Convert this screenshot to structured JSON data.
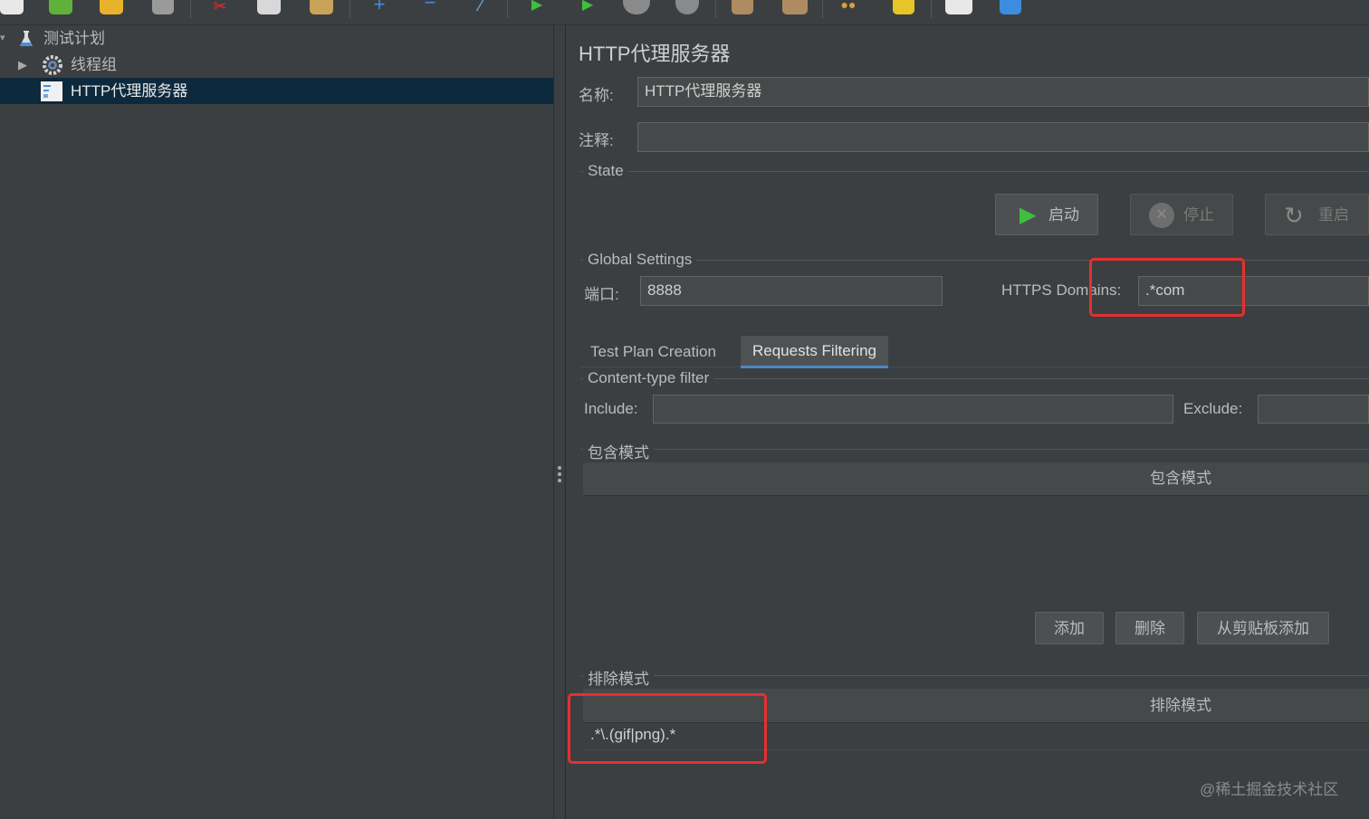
{
  "toolbar": {
    "icons": [
      "new-icon",
      "templates-icon",
      "open-icon",
      "save-icon",
      "cut-icon",
      "copy-icon",
      "paste-icon",
      "expand-icon",
      "collapse-icon",
      "toggle-icon",
      "start-icon",
      "start-no-pause-icon",
      "stop-icon",
      "shutdown-icon",
      "clear-icon",
      "clear-all-icon",
      "search-icon",
      "reset-search-icon",
      "function-helper-icon",
      "help-icon"
    ]
  },
  "tree": {
    "items": [
      {
        "label": "测试计划",
        "icon": "test-plan-icon"
      },
      {
        "label": "线程组",
        "icon": "thread-group-icon"
      },
      {
        "label": "HTTP代理服务器",
        "icon": "proxy-server-icon"
      }
    ]
  },
  "panel": {
    "title": "HTTP代理服务器",
    "name_label": "名称:",
    "name_value": "HTTP代理服务器",
    "comment_label": "注释:",
    "comment_value": "",
    "state": {
      "title": "State",
      "start_label": "启动",
      "stop_label": "停止",
      "restart_label": "重启"
    },
    "global": {
      "title": "Global Settings",
      "port_label": "端口:",
      "port_value": "8888",
      "https_label": "HTTPS Domains:",
      "https_value": ".*com"
    },
    "tabs": [
      {
        "label": "Test Plan Creation",
        "active": false
      },
      {
        "label": "Requests Filtering",
        "active": true
      }
    ],
    "content_filter": {
      "title": "Content-type filter",
      "include_label": "Include:",
      "include_value": "",
      "exclude_label": "Exclude:",
      "exclude_value": ""
    },
    "include_patterns": {
      "title": "包含模式",
      "column": "包含模式",
      "rows": []
    },
    "pattern_buttons": {
      "add": "添加",
      "delete": "删除",
      "add_clipboard": "从剪贴板添加"
    },
    "exclude_patterns": {
      "title": "排除模式",
      "column": "排除模式",
      "rows": [
        ".*\\.(gif|png).*"
      ]
    }
  },
  "watermark": "@稀土掘金技术社区",
  "colors": {
    "background": "#3c3f41",
    "selection": "#0d293e",
    "highlight_box": "#e5302f",
    "tab_underline": "#4a88c7",
    "start_green": "#3fbf3f"
  }
}
